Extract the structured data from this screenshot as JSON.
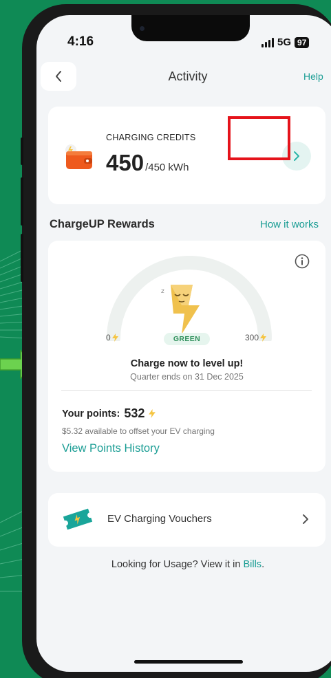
{
  "status_bar": {
    "time": "4:16",
    "network": "5G",
    "battery": "97"
  },
  "header": {
    "title": "Activity",
    "help_label": "Help"
  },
  "credits": {
    "label": "CHARGING CREDITS",
    "value": "450",
    "unit": "/450 kWh"
  },
  "rewards": {
    "section_title": "ChargeUP Rewards",
    "how_it_works_label": "How it works",
    "gauge_min": "0",
    "gauge_max": "300",
    "level": "GREEN",
    "level_message": "Charge now to level up!",
    "quarter_message": "Quarter ends on 31 Dec 2025",
    "points_label": "Your points:",
    "points_value": "532",
    "points_note": "$5.32 available to offset your EV charging",
    "history_link": "View Points History"
  },
  "vouchers": {
    "label": "EV Charging Vouchers"
  },
  "usage": {
    "text": "Looking for Usage? View it in ",
    "link": "Bills",
    "suffix": "."
  },
  "colors": {
    "background": "#0f8a55",
    "accent": "#1a9d94",
    "highlight": "#e5131b",
    "lightning": "#f5c542"
  },
  "icons": {
    "back": "chevron-left-icon",
    "credits": "wallet-icon",
    "credits_open": "chevron-right-icon",
    "info": "info-icon",
    "points": "lightning-icon",
    "vouchers": "ticket-icon",
    "vouchers_open": "chevron-right-icon"
  }
}
